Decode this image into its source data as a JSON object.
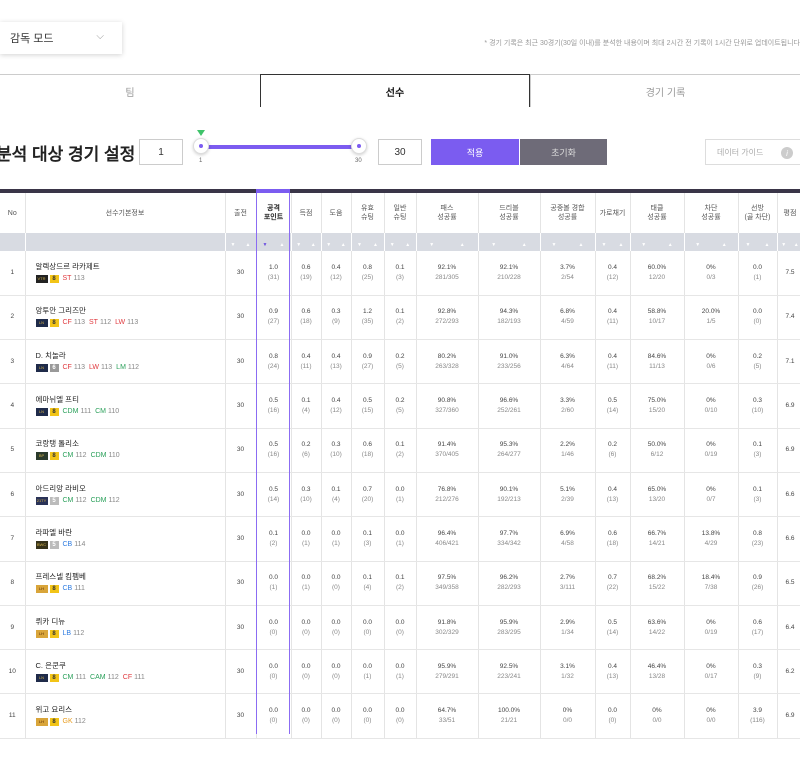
{
  "mode_select": {
    "label": "감독 모드"
  },
  "top_note": "* 경기 기록은 최근 30경기(30일 이내)를 분석한 내용이며 최대 2시간 전 기록이 1시간 단위로 업데이트됩니다",
  "tabs": [
    "팀",
    "선수",
    "경기 기록"
  ],
  "range": {
    "title": "분석 대상 경기 설정",
    "min_value": "1",
    "max_value": "30",
    "slider_min": "1",
    "slider_max": "30",
    "min_fraction": 0,
    "max_fraction": 1,
    "apply": "적용",
    "reset": "초기화",
    "guide": "데이터 가이드",
    "guide_icon": "info-icon"
  },
  "colors": {
    "accent": "#7b5cf0",
    "header_bar": "#3a3548",
    "fw": "#e0393e",
    "mf": "#2aa05a",
    "df": "#2d7be0",
    "gk": "#e89b1c",
    "grade_gold": "#f2c417"
  },
  "columns": [
    "No",
    "선수기본정보",
    "출전",
    "공격\n포인트",
    "득점",
    "도움",
    "유효\n슈팅",
    "일반\n슈팅",
    "패스\n성공률",
    "드리블\n성공률",
    "공중볼 경합\n성공률",
    "가로채기",
    "태클\n성공률",
    "차단\n성공률",
    "선방\n(골 차단)",
    "평점"
  ],
  "players": [
    {
      "no": "1",
      "name": "알렉상드르 라카제트",
      "season": "VTR",
      "grade": "8",
      "positions": [
        {
          "p": "ST",
          "v": "113",
          "c": "fw"
        }
      ],
      "apps": "30",
      "ap": [
        "1.0",
        "(31)"
      ],
      "g": [
        "0.6",
        "(19)"
      ],
      "a": [
        "0.4",
        "(12)"
      ],
      "sot": [
        "0.8",
        "(25)"
      ],
      "sh": [
        "0.1",
        "(3)"
      ],
      "pass": [
        "92.1%",
        "281/305"
      ],
      "drib": [
        "92.1%",
        "210/228"
      ],
      "air": [
        "3.7%",
        "2/54"
      ],
      "int": [
        "0.4",
        "(12)"
      ],
      "tkl": [
        "60.0%",
        "12/20"
      ],
      "blk": [
        "0%",
        "0/3"
      ],
      "sav": [
        "0.0",
        "(1)"
      ],
      "rate": "7.5"
    },
    {
      "no": "2",
      "name": "앙투안 그리즈만",
      "season": "LN",
      "grade": "8",
      "positions": [
        {
          "p": "CF",
          "v": "113",
          "c": "fw"
        },
        {
          "p": "ST",
          "v": "112",
          "c": "fw"
        },
        {
          "p": "LW",
          "v": "113",
          "c": "fw"
        }
      ],
      "apps": "30",
      "ap": [
        "0.9",
        "(27)"
      ],
      "g": [
        "0.6",
        "(18)"
      ],
      "a": [
        "0.3",
        "(9)"
      ],
      "sot": [
        "1.2",
        "(35)"
      ],
      "sh": [
        "0.1",
        "(2)"
      ],
      "pass": [
        "92.8%",
        "272/293"
      ],
      "drib": [
        "94.3%",
        "182/193"
      ],
      "air": [
        "6.8%",
        "4/59"
      ],
      "int": [
        "0.4",
        "(11)"
      ],
      "tkl": [
        "58.8%",
        "10/17"
      ],
      "blk": [
        "20.0%",
        "1/5"
      ],
      "sav": [
        "0.0",
        "(0)"
      ],
      "rate": "7.4"
    },
    {
      "no": "3",
      "name": "D. 치놀라",
      "season": "LN",
      "grade": "6",
      "positions": [
        {
          "p": "CF",
          "v": "113",
          "c": "fw"
        },
        {
          "p": "LW",
          "v": "113",
          "c": "fw"
        },
        {
          "p": "LM",
          "v": "112",
          "c": "mf"
        }
      ],
      "apps": "30",
      "ap": [
        "0.8",
        "(24)"
      ],
      "g": [
        "0.4",
        "(11)"
      ],
      "a": [
        "0.4",
        "(13)"
      ],
      "sot": [
        "0.9",
        "(27)"
      ],
      "sh": [
        "0.2",
        "(5)"
      ],
      "pass": [
        "80.2%",
        "263/328"
      ],
      "drib": [
        "91.0%",
        "233/256"
      ],
      "air": [
        "6.3%",
        "4/64"
      ],
      "int": [
        "0.4",
        "(11)"
      ],
      "tkl": [
        "84.6%",
        "11/13"
      ],
      "blk": [
        "0%",
        "0/6"
      ],
      "sav": [
        "0.2",
        "(5)"
      ],
      "rate": "7.1"
    },
    {
      "no": "4",
      "name": "에마뉘엘 프티",
      "season": "LN",
      "grade": "8",
      "positions": [
        {
          "p": "CDM",
          "v": "111",
          "c": "mf"
        },
        {
          "p": "CM",
          "v": "110",
          "c": "mf"
        }
      ],
      "apps": "30",
      "ap": [
        "0.5",
        "(16)"
      ],
      "g": [
        "0.1",
        "(4)"
      ],
      "a": [
        "0.4",
        "(12)"
      ],
      "sot": [
        "0.5",
        "(15)"
      ],
      "sh": [
        "0.2",
        "(5)"
      ],
      "pass": [
        "90.8%",
        "327/360"
      ],
      "drib": [
        "96.6%",
        "252/261"
      ],
      "air": [
        "3.3%",
        "2/60"
      ],
      "int": [
        "0.5",
        "(14)"
      ],
      "tkl": [
        "75.0%",
        "15/20"
      ],
      "blk": [
        "0%",
        "0/10"
      ],
      "sav": [
        "0.3",
        "(10)"
      ],
      "rate": "6.9"
    },
    {
      "no": "5",
      "name": "코랑탱 톨리소",
      "season": "BP",
      "grade": "8",
      "positions": [
        {
          "p": "CM",
          "v": "112",
          "c": "mf"
        },
        {
          "p": "CDM",
          "v": "110",
          "c": "mf"
        }
      ],
      "apps": "30",
      "ap": [
        "0.5",
        "(16)"
      ],
      "g": [
        "0.2",
        "(6)"
      ],
      "a": [
        "0.3",
        "(10)"
      ],
      "sot": [
        "0.6",
        "(18)"
      ],
      "sh": [
        "0.1",
        "(2)"
      ],
      "pass": [
        "91.4%",
        "370/405"
      ],
      "drib": [
        "95.3%",
        "264/277"
      ],
      "air": [
        "2.2%",
        "1/46"
      ],
      "int": [
        "0.2",
        "(6)"
      ],
      "tkl": [
        "50.0%",
        "6/12"
      ],
      "blk": [
        "0%",
        "0/19"
      ],
      "sav": [
        "0.1",
        "(3)"
      ],
      "rate": "6.9"
    },
    {
      "no": "6",
      "name": "아드리앙 라비오",
      "season": "21TY",
      "grade": "5",
      "positions": [
        {
          "p": "CM",
          "v": "112",
          "c": "mf"
        },
        {
          "p": "CDM",
          "v": "112",
          "c": "mf"
        }
      ],
      "apps": "30",
      "ap": [
        "0.5",
        "(14)"
      ],
      "g": [
        "0.3",
        "(10)"
      ],
      "a": [
        "0.1",
        "(4)"
      ],
      "sot": [
        "0.7",
        "(20)"
      ],
      "sh": [
        "0.0",
        "(1)"
      ],
      "pass": [
        "76.8%",
        "212/276"
      ],
      "drib": [
        "90.1%",
        "192/213"
      ],
      "air": [
        "5.1%",
        "2/39"
      ],
      "int": [
        "0.4",
        "(13)"
      ],
      "tkl": [
        "65.0%",
        "13/20"
      ],
      "blk": [
        "0%",
        "0/7"
      ],
      "sav": [
        "0.1",
        "(3)"
      ],
      "rate": "6.6"
    },
    {
      "no": "7",
      "name": "라파엘 바란",
      "season": "BWC",
      "grade": "5",
      "positions": [
        {
          "p": "CB",
          "v": "114",
          "c": "df"
        }
      ],
      "apps": "30",
      "ap": [
        "0.1",
        "(2)"
      ],
      "g": [
        "0.0",
        "(1)"
      ],
      "a": [
        "0.0",
        "(1)"
      ],
      "sot": [
        "0.1",
        "(3)"
      ],
      "sh": [
        "0.0",
        "(1)"
      ],
      "pass": [
        "96.4%",
        "406/421"
      ],
      "drib": [
        "97.7%",
        "334/342"
      ],
      "air": [
        "6.9%",
        "4/58"
      ],
      "int": [
        "0.6",
        "(18)"
      ],
      "tkl": [
        "66.7%",
        "14/21"
      ],
      "blk": [
        "13.8%",
        "4/29"
      ],
      "sav": [
        "0.8",
        "(23)"
      ],
      "rate": "6.6"
    },
    {
      "no": "8",
      "name": "프레스넬 킴펨베",
      "season": "LH",
      "grade": "8",
      "positions": [
        {
          "p": "CB",
          "v": "111",
          "c": "df"
        }
      ],
      "apps": "30",
      "ap": [
        "0.0",
        "(1)"
      ],
      "g": [
        "0.0",
        "(1)"
      ],
      "a": [
        "0.0",
        "(0)"
      ],
      "sot": [
        "0.1",
        "(4)"
      ],
      "sh": [
        "0.1",
        "(2)"
      ],
      "pass": [
        "97.5%",
        "349/358"
      ],
      "drib": [
        "96.2%",
        "282/293"
      ],
      "air": [
        "2.7%",
        "3/111"
      ],
      "int": [
        "0.7",
        "(22)"
      ],
      "tkl": [
        "68.2%",
        "15/22"
      ],
      "blk": [
        "18.4%",
        "7/38"
      ],
      "sav": [
        "0.9",
        "(26)"
      ],
      "rate": "6.5"
    },
    {
      "no": "9",
      "name": "뤼카 디뉴",
      "season": "LH",
      "grade": "8",
      "positions": [
        {
          "p": "LB",
          "v": "112",
          "c": "df"
        }
      ],
      "apps": "30",
      "ap": [
        "0.0",
        "(0)"
      ],
      "g": [
        "0.0",
        "(0)"
      ],
      "a": [
        "0.0",
        "(0)"
      ],
      "sot": [
        "0.0",
        "(0)"
      ],
      "sh": [
        "0.0",
        "(0)"
      ],
      "pass": [
        "91.8%",
        "302/329"
      ],
      "drib": [
        "95.9%",
        "283/295"
      ],
      "air": [
        "2.9%",
        "1/34"
      ],
      "int": [
        "0.5",
        "(14)"
      ],
      "tkl": [
        "63.6%",
        "14/22"
      ],
      "blk": [
        "0%",
        "0/19"
      ],
      "sav": [
        "0.6",
        "(17)"
      ],
      "rate": "6.4"
    },
    {
      "no": "10",
      "name": "C. 은쿤쿠",
      "season": "LN",
      "grade": "8",
      "positions": [
        {
          "p": "CM",
          "v": "111",
          "c": "mf"
        },
        {
          "p": "CAM",
          "v": "112",
          "c": "mf"
        },
        {
          "p": "CF",
          "v": "111",
          "c": "fw"
        }
      ],
      "apps": "30",
      "ap": [
        "0.0",
        "(0)"
      ],
      "g": [
        "0.0",
        "(0)"
      ],
      "a": [
        "0.0",
        "(0)"
      ],
      "sot": [
        "0.0",
        "(1)"
      ],
      "sh": [
        "0.0",
        "(1)"
      ],
      "pass": [
        "95.9%",
        "279/291"
      ],
      "drib": [
        "92.5%",
        "223/241"
      ],
      "air": [
        "3.1%",
        "1/32"
      ],
      "int": [
        "0.4",
        "(13)"
      ],
      "tkl": [
        "46.4%",
        "13/28"
      ],
      "blk": [
        "0%",
        "0/17"
      ],
      "sav": [
        "0.3",
        "(9)"
      ],
      "rate": "6.2"
    },
    {
      "no": "11",
      "name": "위고 요리스",
      "season": "LH",
      "grade": "8",
      "positions": [
        {
          "p": "GK",
          "v": "112",
          "c": "gk"
        }
      ],
      "apps": "30",
      "ap": [
        "0.0",
        "(0)"
      ],
      "g": [
        "0.0",
        "(0)"
      ],
      "a": [
        "0.0",
        "(0)"
      ],
      "sot": [
        "0.0",
        "(0)"
      ],
      "sh": [
        "0.0",
        "(0)"
      ],
      "pass": [
        "64.7%",
        "33/51"
      ],
      "drib": [
        "100.0%",
        "21/21"
      ],
      "air": [
        "0%",
        "0/0"
      ],
      "int": [
        "0.0",
        "(0)"
      ],
      "tkl": [
        "0%",
        "0/0"
      ],
      "blk": [
        "0%",
        "0/0"
      ],
      "sav": [
        "3.9",
        "(116)"
      ],
      "rate": "6.9"
    }
  ]
}
